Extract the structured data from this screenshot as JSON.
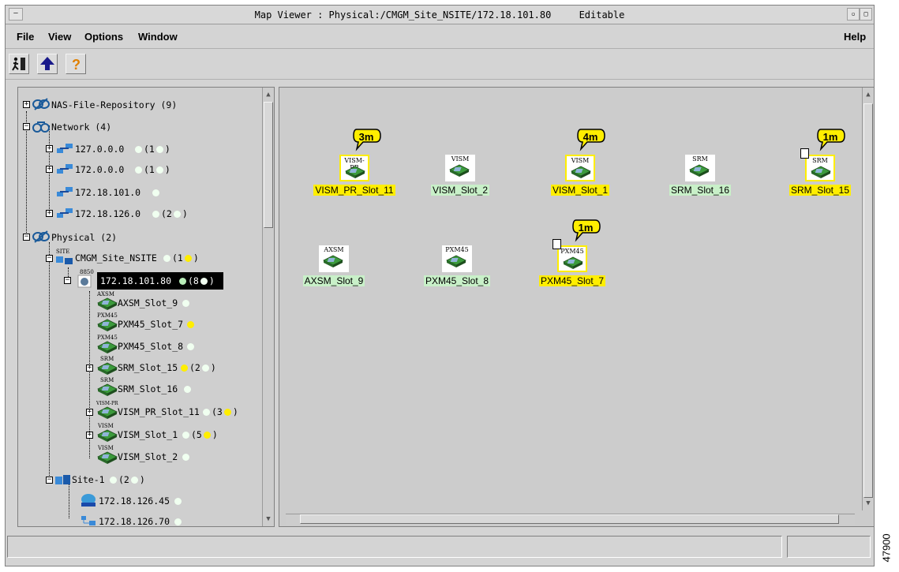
{
  "window": {
    "title": "Map Viewer : Physical:/CMGM_Site_NSITE/172.18.101.80",
    "mode": "Editable"
  },
  "menu": {
    "file": "File",
    "view": "View",
    "options": "Options",
    "window": "Window",
    "help": "Help"
  },
  "toolbar": {
    "exit_icon": "exit-icon",
    "up_icon": "up-arrow-icon",
    "help_icon": "help-question-icon"
  },
  "tree": {
    "nas": {
      "label": "NAS-File-Repository (9)"
    },
    "network": {
      "label": "Network (4)"
    },
    "net1": {
      "label": "127.0.0.0",
      "count": "(1",
      "close": ")"
    },
    "net2": {
      "label": "172.0.0.0",
      "count": "(1",
      "close": ")"
    },
    "net3": {
      "label": "172.18.101.0"
    },
    "net4": {
      "label": "172.18.126.0",
      "count": "(2",
      "close": ")"
    },
    "physical": {
      "label": "Physical (2)"
    },
    "site": {
      "icon_tag": "SITE",
      "label": "CMGM_Site_NSITE",
      "count": "(1",
      "close": ")"
    },
    "node": {
      "icon_tag": "8850",
      "label": "172.18.101.80",
      "count": "(8",
      "close": ")"
    },
    "slots": [
      {
        "tag": "AXSM",
        "label": "AXSM_Slot_9"
      },
      {
        "tag": "PXM45",
        "label": "PXM45_Slot_7"
      },
      {
        "tag": "PXM45",
        "label": "PXM45_Slot_8"
      },
      {
        "tag": "SRM",
        "label": "SRM_Slot_15",
        "count": "(2",
        "close": ")"
      },
      {
        "tag": "SRM",
        "label": "SRM_Slot_16"
      },
      {
        "tag": "VISM-PR",
        "label": "VISM_PR_Slot_11",
        "count": "(3",
        "close": ")"
      },
      {
        "tag": "VISM",
        "label": "VISM_Slot_1",
        "count": "(5",
        "close": ")"
      },
      {
        "tag": "VISM",
        "label": "VISM_Slot_2"
      }
    ],
    "site1": {
      "label": "Site-1",
      "count": "(2",
      "close": ")"
    },
    "host1": {
      "label": "172.18.126.45"
    },
    "host2": {
      "label": "172.18.126.70"
    }
  },
  "map": {
    "cards": [
      {
        "tag": "VISM-PR",
        "name": "VISM_PR_Slot_11",
        "badge": "3m",
        "status": "minor"
      },
      {
        "tag": "VISM",
        "name": "VISM_Slot_2",
        "status": "ok"
      },
      {
        "tag": "VISM",
        "name": "VISM_Slot_1",
        "badge": "4m",
        "status": "minor"
      },
      {
        "tag": "SRM",
        "name": "SRM_Slot_16",
        "status": "ok"
      },
      {
        "tag": "SRM",
        "name": "SRM_Slot_15",
        "badge": "1m",
        "status": "minor"
      },
      {
        "tag": "AXSM",
        "name": "AXSM_Slot_9",
        "status": "ok"
      },
      {
        "tag": "PXM45",
        "name": "PXM45_Slot_8",
        "status": "ok"
      },
      {
        "tag": "PXM45",
        "name": "PXM45_Slot_7",
        "badge": "1m",
        "status": "minor"
      }
    ]
  },
  "figure_number": "47900",
  "colors": {
    "minor": "#ffee00",
    "ok": "#b8ecb8",
    "panel": "#cccccc"
  }
}
